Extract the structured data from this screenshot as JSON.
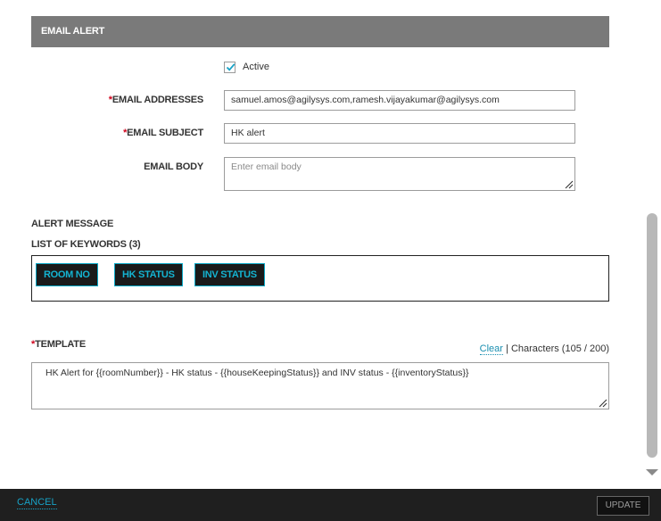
{
  "section": {
    "title": "EMAIL ALERT"
  },
  "active": {
    "label": "Active",
    "checked": true
  },
  "fields": {
    "email_addresses": {
      "required_mark": "*",
      "label": "EMAIL ADDRESSES",
      "value": "samuel.amos@agilysys.com,ramesh.vijayakumar@agilysys.com"
    },
    "email_subject": {
      "required_mark": "*",
      "label": "EMAIL SUBJECT",
      "value": "HK alert"
    },
    "email_body": {
      "label": "EMAIL BODY",
      "placeholder": "Enter email body",
      "value": ""
    }
  },
  "alert_message": {
    "heading": "ALERT MESSAGE"
  },
  "keywords": {
    "heading": "LIST OF KEYWORDS (3)",
    "items": [
      "ROOM NO",
      "HK STATUS",
      "INV STATUS"
    ]
  },
  "template": {
    "required_mark": "*",
    "label": "TEMPLATE",
    "clear_label": "Clear",
    "separator": "|",
    "characters_text": "Characters (105 / 200)",
    "value": "HK Alert for {{roomNumber}} - HK status - {{houseKeepingStatus}} and INV status -  {{inventoryStatus}}"
  },
  "footer": {
    "cancel_label": "CANCEL",
    "update_label": "UPDATE"
  },
  "colors": {
    "accent": "#17a2c6",
    "header_bg": "#7a7a7a",
    "footer_bg": "#1f1f1f",
    "required": "#d0021b"
  }
}
